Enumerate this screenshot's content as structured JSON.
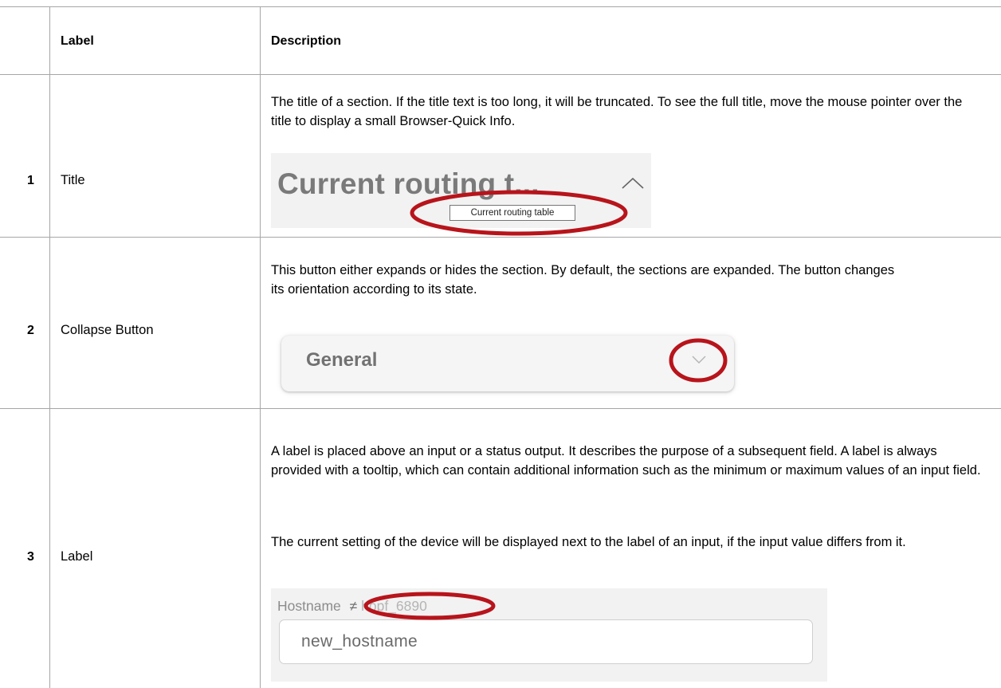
{
  "table": {
    "headers": {
      "label": "Label",
      "description": "Description"
    },
    "rows": [
      {
        "number": "1",
        "label": "Title",
        "description": [
          "The title of a section. If the title text is too long, it will be truncated. To see the full title, move the mouse pointer over the title to display a small Browser-Quick Info."
        ],
        "example": {
          "title_text": "Current routing t...",
          "tooltip_text": "Current routing table",
          "icon": "chevron-up-icon"
        }
      },
      {
        "number": "2",
        "label": "Collapse Button",
        "description": [
          "This button either expands or hides the section. By default, the sections are expanded. The button changes its orientation according to its state."
        ],
        "example": {
          "section_title": "General",
          "icon": "chevron-down-icon"
        }
      },
      {
        "number": "3",
        "label": "Label",
        "description": [
          "A label is placed above an input or a status output. It describes the purpose of a subsequent field. A label is always provided with a tooltip, which can contain additional information such as the minimum or maximum values of an input field.",
          "The current setting of the device will be displayed next to the label of an input, if the input value differs from it."
        ],
        "example": {
          "field_label": "Hostname",
          "not_equal_symbol": "≠",
          "current_value": "hopf_6890",
          "input_value": "new_hostname"
        }
      }
    ]
  },
  "colors": {
    "highlight_ring": "#b8141b",
    "grid": "#a6a6a6"
  }
}
